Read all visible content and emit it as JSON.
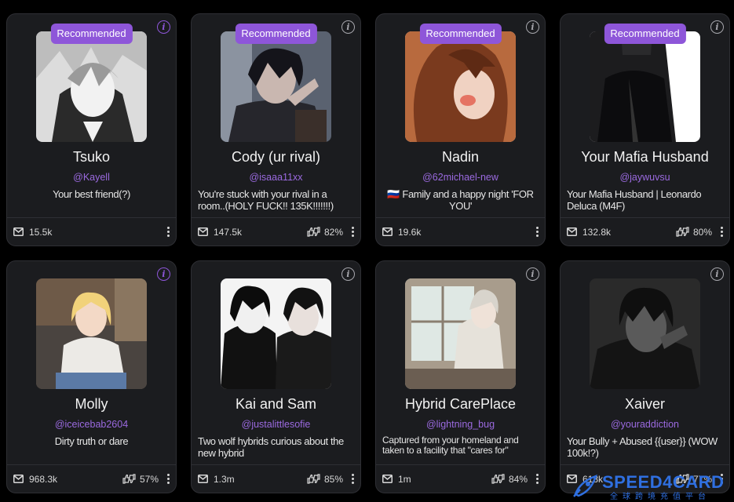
{
  "recommended_label": "Recommended",
  "cards": [
    {
      "name": "Tsuko",
      "handle": "@Kayell",
      "description": "Your best friend(?)",
      "messages": "15.5k",
      "likes": "",
      "recommended": true
    },
    {
      "name": "Cody (ur rival)",
      "handle": "@isaaa11xx",
      "description": "You're stuck with your rival in a room..(HOLY FUCK!! 135K!!!!!!!)",
      "messages": "147.5k",
      "likes": "82%",
      "recommended": true
    },
    {
      "name": "Nadin",
      "handle": "@62michael-new",
      "description": "🇷🇺 Family and a happy night 'FOR YOU'",
      "messages": "19.6k",
      "likes": "",
      "recommended": true
    },
    {
      "name": "Your Mafia Husband",
      "handle": "@jaywuvsu",
      "description": "Your Mafia Husband | Leonardo Deluca (M4F)",
      "messages": "132.8k",
      "likes": "80%",
      "recommended": true
    },
    {
      "name": "Molly",
      "handle": "@iceicebab2604",
      "description": "Dirty truth or dare",
      "messages": "968.3k",
      "likes": "57%",
      "recommended": false
    },
    {
      "name": "Kai and Sam",
      "handle": "@justalittlesofie",
      "description": "Two wolf hybrids curious about the new hybrid",
      "messages": "1.3m",
      "likes": "85%",
      "recommended": false
    },
    {
      "name": "Hybrid CarePlace",
      "handle": "@lightning_bug",
      "description": "Captured from your homeland and taken to a facility that \"cares for\" hybrids (Maybe NSFW)",
      "messages": "1m",
      "likes": "84%",
      "recommended": false
    },
    {
      "name": "Xaiver",
      "handle": "@youraddiction",
      "description": "Your Bully + Abused {{user}} (WOW 100k!?)",
      "messages": "618k",
      "likes": "77%",
      "recommended": false
    }
  ],
  "watermark": {
    "title": "SPEED4CARD",
    "subtitle": "全球跨境充值平台"
  },
  "colors": {
    "accent": "#8e56d9",
    "handle": "#9b6ae0",
    "card_bg": "#1b1c1f",
    "page_bg": "#000000",
    "watermark": "#2f6fe0"
  },
  "icons": {
    "info": "info-icon",
    "messages": "mail-icon",
    "likes": "thumbs-up-down-icon",
    "more": "more-vertical-icon"
  }
}
